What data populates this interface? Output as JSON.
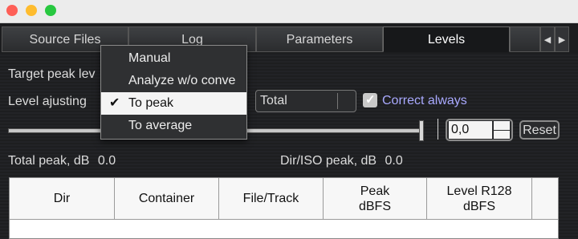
{
  "tabs": [
    {
      "label": "Source Files"
    },
    {
      "label": "Log"
    },
    {
      "label": "Parameters"
    },
    {
      "label": "Levels"
    }
  ],
  "nav": {
    "left": "◀",
    "right": "▶"
  },
  "target_peak": {
    "label": "Target peak lev"
  },
  "level_adjusting": {
    "label": "Level ajusting"
  },
  "menu": {
    "items": [
      {
        "label": "Manual",
        "checked": false
      },
      {
        "label": "Analyze w/o conve",
        "checked": false
      },
      {
        "label": "To peak",
        "checked": true
      },
      {
        "label": "To average",
        "checked": false
      }
    ],
    "checkmark": "✔"
  },
  "scope_combo": {
    "value": "Total"
  },
  "correct_always": {
    "label": "Correct always",
    "checked": true,
    "checkmark": "✓",
    "color": "#a9a9ff"
  },
  "level_value": {
    "value": "0,0"
  },
  "reset_button": {
    "label": "Reset"
  },
  "total_peak": {
    "label": "Total peak, dB",
    "value": "0.0"
  },
  "dir_iso_peak": {
    "label": "Dir/ISO peak, dB",
    "value": "0.0"
  },
  "table": {
    "columns": [
      {
        "line1": "Dir",
        "line2": ""
      },
      {
        "line1": "Container",
        "line2": ""
      },
      {
        "line1": "File/Track",
        "line2": ""
      },
      {
        "line1": "Peak",
        "line2": "dBFS"
      },
      {
        "line1": "Level R128",
        "line2": "dBFS"
      }
    ]
  }
}
